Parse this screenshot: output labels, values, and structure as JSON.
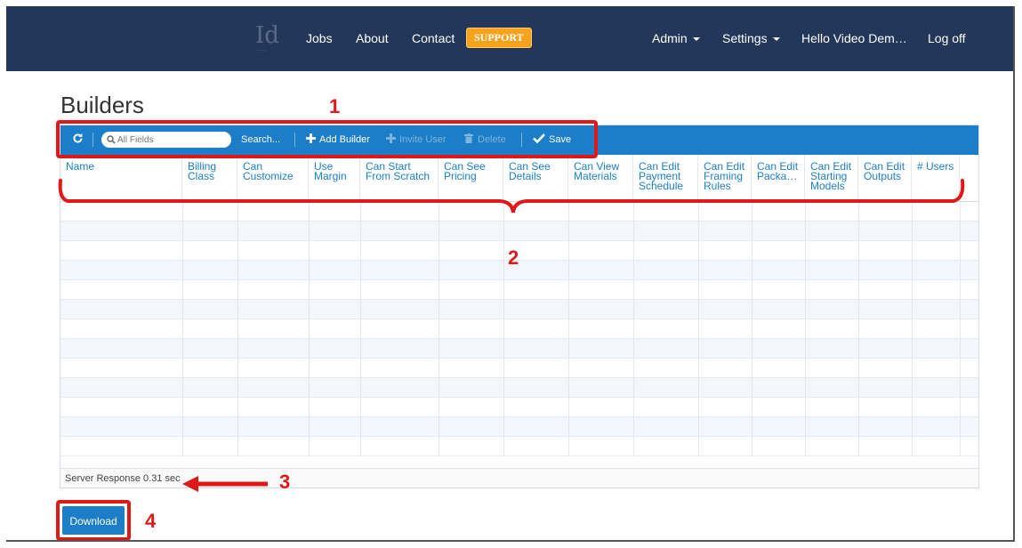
{
  "nav": {
    "logo_text": "Id",
    "logo_sub": "······",
    "links": {
      "jobs": "Jobs",
      "about": "About",
      "contact": "Contact",
      "support": "SUPPORT"
    },
    "admin": "Admin",
    "settings": "Settings",
    "user": "Hello Video Dem…",
    "logoff": "Log off"
  },
  "page_title": "Builders",
  "toolbar": {
    "search_placeholder": "All Fields",
    "search_label": "Search...",
    "add_builder": "Add Builder",
    "invite_user": "Invite User",
    "delete": "Delete",
    "save": "Save"
  },
  "columns": [
    [
      "Name"
    ],
    [
      "Billing",
      "Class"
    ],
    [
      "Can",
      "Customize"
    ],
    [
      "Use",
      "Margin"
    ],
    [
      "Can Start",
      "From Scratch"
    ],
    [
      "Can See",
      "Pricing"
    ],
    [
      "Can See",
      "Details"
    ],
    [
      "Can View",
      "Materials"
    ],
    [
      "Can Edit",
      "Payment",
      "Schedule"
    ],
    [
      "Can Edit",
      "Framing",
      "Rules"
    ],
    [
      "Can Edit",
      "Packa…"
    ],
    [
      "Can Edit",
      "Starting",
      "Models"
    ],
    [
      "Can Edit",
      "Outputs"
    ],
    [
      "# Users"
    ]
  ],
  "footer": {
    "server_response": "Server Response 0.31 sec"
  },
  "download_label": "Download",
  "annotations": {
    "n1": "1",
    "n2": "2",
    "n3": "3",
    "n4": "4"
  },
  "colors": {
    "navbar": "#23375b",
    "accent": "#1c7ec8",
    "support": "#f6a21c",
    "annotation": "#e01818"
  }
}
